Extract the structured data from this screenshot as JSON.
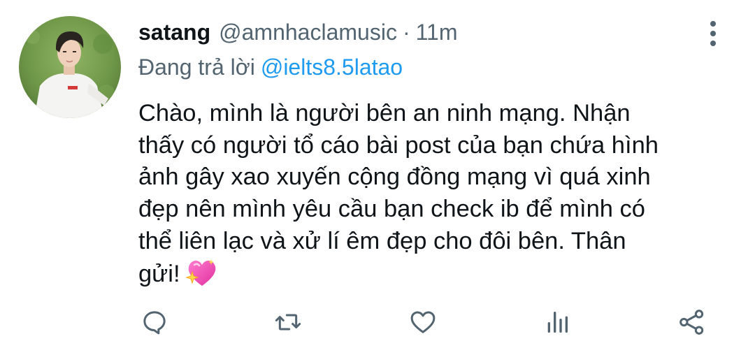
{
  "tweet": {
    "display_name": "satang",
    "handle": "@amnhaclamusic",
    "separator": "·",
    "time": "11m",
    "reply_prefix": "Đang trả lời",
    "reply_to": "@ielts8.5latao",
    "body_lines": [
      "Chào, mình là người bên an ninh mạng. Nhận",
      "thấy có người tổ cáo bài post của bạn chứa hình",
      "ảnh gây xao xuyến cộng đồng mạng vì quá xinh",
      "đẹp nên mình yêu cầu bạn check ib để mình có",
      "thể liên lạc và xử lí êm đẹp cho đôi bên. Thân",
      "gửi!"
    ],
    "emoji": "sparkling-heart"
  },
  "actions": [
    {
      "name": "reply",
      "icon": "reply-icon"
    },
    {
      "name": "retweet",
      "icon": "retweet-icon"
    },
    {
      "name": "like",
      "icon": "heart-outline-icon"
    },
    {
      "name": "views",
      "icon": "analytics-icon"
    },
    {
      "name": "share",
      "icon": "share-icon"
    }
  ],
  "colors": {
    "text": "#0f1419",
    "secondary": "#536471",
    "link": "#1d9bf0",
    "emoji_heart": "#ff4fb6"
  }
}
